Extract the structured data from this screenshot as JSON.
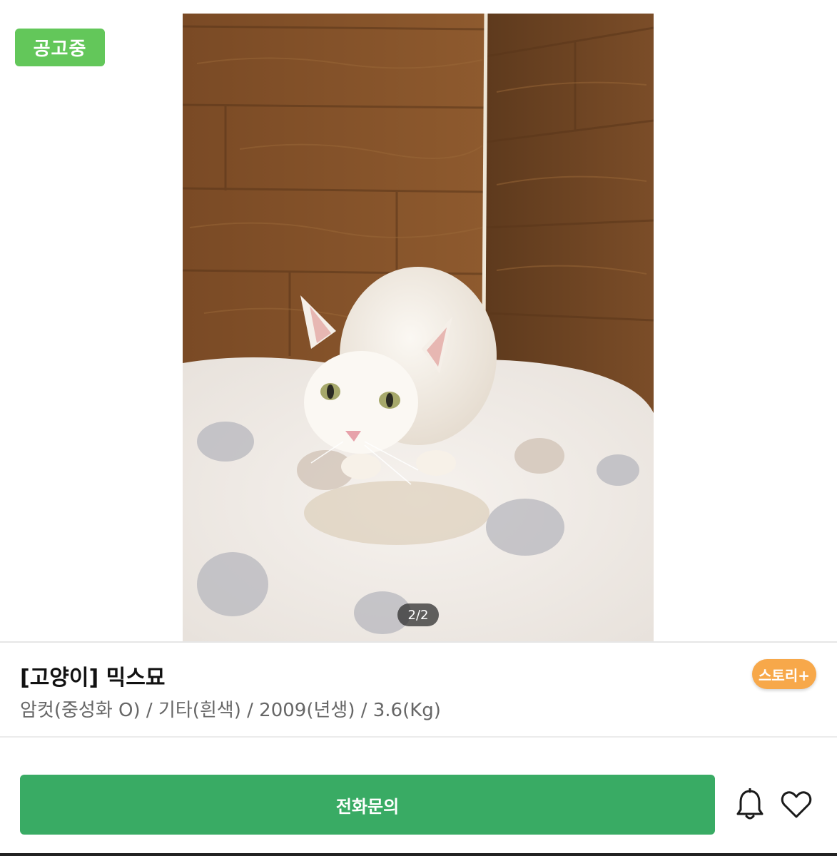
{
  "status_badge": "공고중",
  "photo": {
    "page_indicator": "2/2"
  },
  "pet": {
    "title": "[고양이] 믹스묘",
    "info": "암컷(중성화 O) / 기타(흰색) / 2009(년생) / 3.6(Kg)"
  },
  "story_badge": "스토리+",
  "actions": {
    "call_label": "전화문의",
    "bell_icon": "bell-icon",
    "heart_icon": "heart-icon"
  },
  "colors": {
    "status_green": "#63c75a",
    "call_green": "#39ab64",
    "story_orange": "#f7a84a"
  }
}
